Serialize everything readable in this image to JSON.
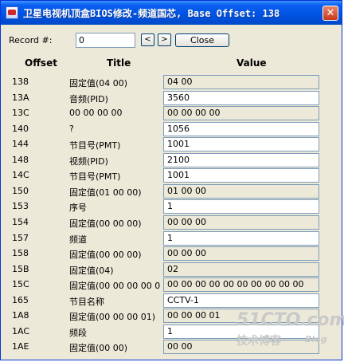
{
  "window": {
    "title": "卫星电视机顶盒BIOS修改-频道国芯, Base Offset: 138",
    "close_glyph": "✕"
  },
  "record": {
    "label": "Record #:",
    "value": "0",
    "prev_label": "<",
    "next_label": ">",
    "close_label": "Close"
  },
  "headers": {
    "offset": "Offset",
    "title": "Title",
    "value": "Value"
  },
  "rows": [
    {
      "offset": "138",
      "title": "固定值(04 00)",
      "value": "04 00",
      "editable": false
    },
    {
      "offset": "13A",
      "title": "音频(PID)",
      "value": "3560",
      "editable": true
    },
    {
      "offset": "13C",
      "title": "00 00 00 00",
      "value": "00 00 00 00",
      "editable": false
    },
    {
      "offset": "140",
      "title": "?",
      "value": "1056",
      "editable": true
    },
    {
      "offset": "144",
      "title": "节目号(PMT)",
      "value": "1001",
      "editable": true
    },
    {
      "offset": "148",
      "title": "视频(PID)",
      "value": "2100",
      "editable": true
    },
    {
      "offset": "14C",
      "title": "节目号(PMT)",
      "value": "1001",
      "editable": true
    },
    {
      "offset": "150",
      "title": "固定值(01 00 00)",
      "value": "01 00 00",
      "editable": false
    },
    {
      "offset": "153",
      "title": "序号",
      "value": "1",
      "editable": true
    },
    {
      "offset": "154",
      "title": "固定值(00 00 00)",
      "value": "00 00 00",
      "editable": false
    },
    {
      "offset": "157",
      "title": "频道",
      "value": "1",
      "editable": true
    },
    {
      "offset": "158",
      "title": "固定值(00 00 00)",
      "value": "00 00 00",
      "editable": false
    },
    {
      "offset": "15B",
      "title": "固定值(04)",
      "value": "02",
      "editable": false
    },
    {
      "offset": "15C",
      "title": "固定值(00 00 00 00 0",
      "value": "00 00 00 00 00 00 00 00 00 00",
      "editable": false
    },
    {
      "offset": "165",
      "title": "节目名称",
      "value": "CCTV-1",
      "editable": true
    },
    {
      "offset": "1A8",
      "title": "固定值(00 00 00 01)",
      "value": "00 00 00 01",
      "editable": false
    },
    {
      "offset": "1AC",
      "title": "频段",
      "value": "1",
      "editable": true
    },
    {
      "offset": "1AE",
      "title": "固定值(00 00)",
      "value": "00 00",
      "editable": false
    }
  ],
  "watermark": {
    "line1": "51CTO.com",
    "line2": "技术博客",
    "line3": "Blog"
  }
}
